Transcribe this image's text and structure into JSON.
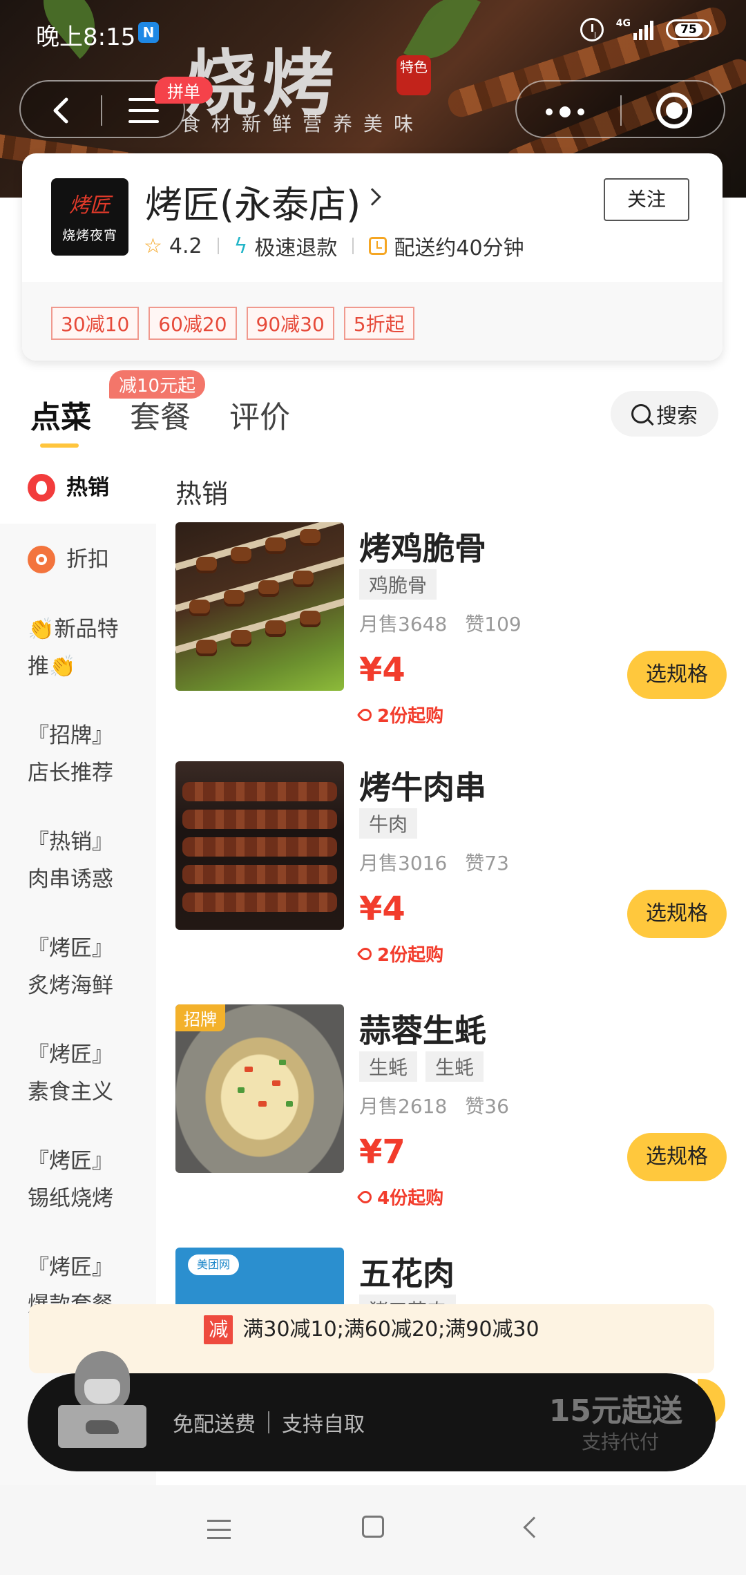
{
  "status_bar": {
    "time": "晚上8:15",
    "app_badge": "N",
    "network": "4G",
    "battery": "75"
  },
  "banner": {
    "title": "烧烤",
    "subtitle": "食材新鲜营养美味",
    "stamp": "特色"
  },
  "nav": {
    "group_badge": "拼单",
    "icons": [
      "back-arrow-icon",
      "menu-icon",
      "more-dots-icon",
      "target-icon"
    ]
  },
  "store": {
    "logo_top": "烤匠",
    "logo_bottom": "烧烤夜宵",
    "name": "烤匠(永泰店)",
    "follow_label": "关注",
    "rating": "4.2",
    "refund": "极速退款",
    "delivery": "配送约40分钟",
    "promos": [
      "30减10",
      "60减20",
      "90减30",
      "5折起"
    ]
  },
  "tabs": {
    "items": [
      "点菜",
      "套餐",
      "评价"
    ],
    "active_index": 0,
    "badge": "减10元起",
    "search_label": "搜索"
  },
  "sidebar": {
    "items": [
      {
        "label": "热销",
        "icon": "hot-icon"
      },
      {
        "label": "折扣",
        "icon": "discount-icon"
      },
      {
        "line1": "👏新品特",
        "line2": "推👏"
      },
      {
        "line1": "『招牌』",
        "line2": "店长推荐"
      },
      {
        "line1": "『热销』",
        "line2": "肉串诱惑"
      },
      {
        "line1": "『烤匠』",
        "line2": "炙烤海鲜"
      },
      {
        "line1": "『烤匠』",
        "line2": "素食主义"
      },
      {
        "line1": "『烤匠』",
        "line2": "锡纸烧烤"
      },
      {
        "line1": "『烤匠』",
        "line2": "爆款套餐"
      }
    ]
  },
  "section_title": "热销",
  "products": [
    {
      "name": "烤鸡脆骨",
      "tags": [
        "鸡脆骨"
      ],
      "sales": "月售3648",
      "likes": "赞109",
      "price": "¥4",
      "min": "2份起购",
      "button": "选规格"
    },
    {
      "name": "烤牛肉串",
      "tags": [
        "牛肉"
      ],
      "sales": "月售3016",
      "likes": "赞73",
      "price": "¥4",
      "min": "2份起购",
      "button": "选规格"
    },
    {
      "name": "蒜蓉生蚝",
      "tags": [
        "生蚝",
        "生蚝"
      ],
      "sales": "月售2618",
      "likes": "赞36",
      "price": "¥7",
      "min": "4份起购",
      "button": "选规格",
      "badge": "招牌"
    },
    {
      "name": "五花肉",
      "tags": [
        "猪五花肉"
      ],
      "watermark": "美团网"
    }
  ],
  "promo_strip": {
    "label": "减",
    "text": "满30减10;满60减20;满90减30"
  },
  "cart": {
    "free_delivery": "免配送费",
    "pickup": "支持自取",
    "min_order": "15元起送",
    "proxy": "支持代付"
  },
  "colors": {
    "accent_yellow": "#ffc83d",
    "price_red": "#f23c2c",
    "badge_red": "#f5424a"
  }
}
